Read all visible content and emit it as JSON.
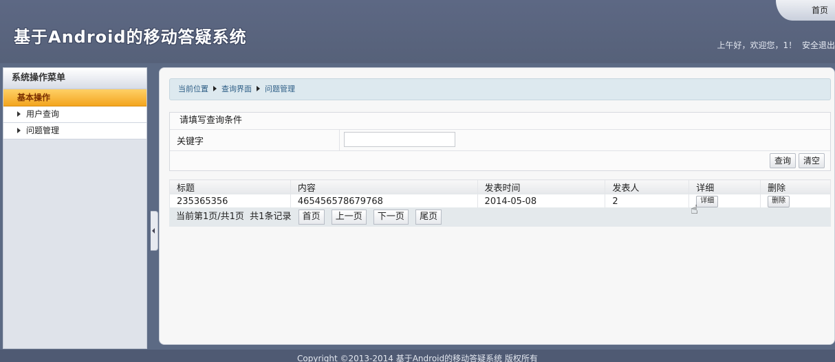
{
  "header": {
    "home_label": "首页",
    "app_title": "基于Android的移动答疑系统",
    "greeting": "上午好，欢迎您，1！",
    "logout_label": "安全退出"
  },
  "sidebar": {
    "title": "系统操作菜单",
    "group_label": "基本操作",
    "items": [
      {
        "label": "用户查询"
      },
      {
        "label": "问题管理"
      }
    ]
  },
  "breadcrumb": {
    "items": [
      "当前位置",
      "查询界面",
      "问题管理"
    ]
  },
  "query": {
    "title": "请填写查询条件",
    "keyword_label": "关键字",
    "keyword_value": "",
    "search_label": "查询",
    "clear_label": "清空"
  },
  "table": {
    "columns": [
      "标题",
      "内容",
      "发表时间",
      "发表人",
      "详细",
      "删除"
    ],
    "rows": [
      {
        "title": "235365356",
        "content": "465456578679768",
        "time": "2014-05-08",
        "author": "2",
        "detail_label": "详细",
        "delete_label": "删除"
      }
    ]
  },
  "pager": {
    "summary": "当前第1页/共1页  共1条记录",
    "first": "首页",
    "prev": "上一页",
    "next": "下一页",
    "last": "尾页"
  },
  "footer": {
    "copyright": "Copyright ©2013-2014 基于Android的移动答疑系统 版权所有"
  }
}
